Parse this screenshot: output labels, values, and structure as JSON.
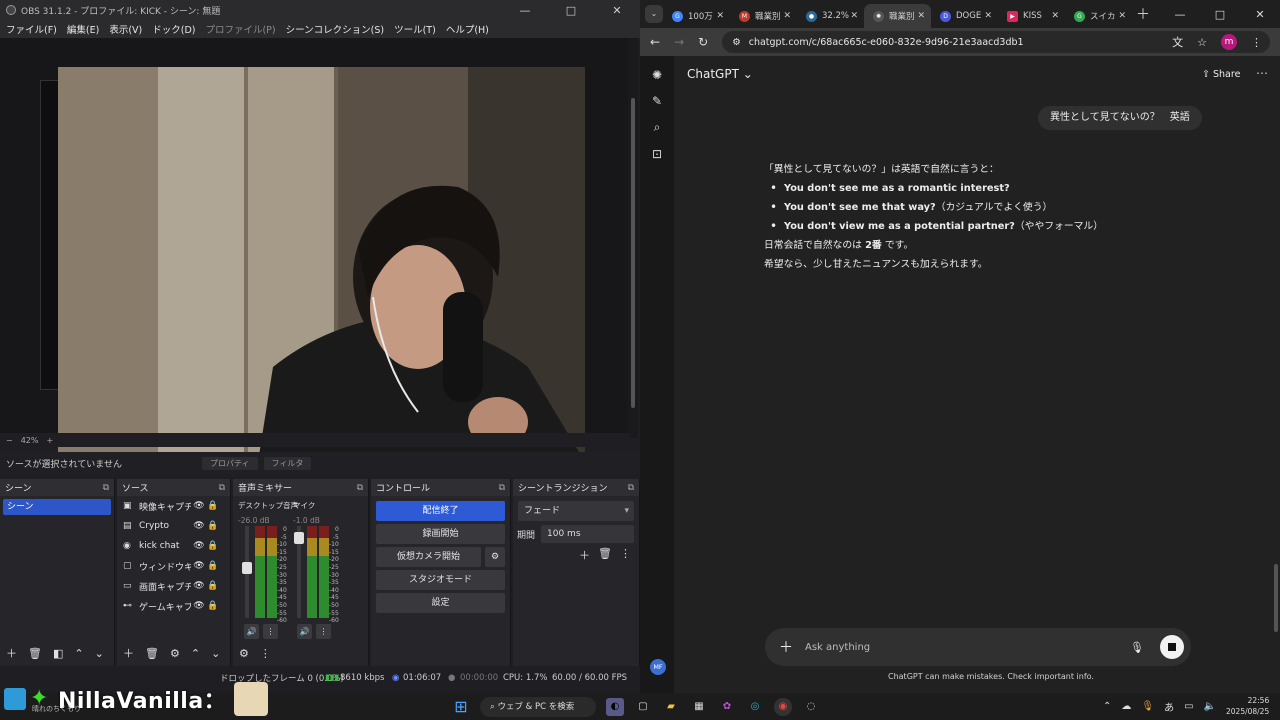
{
  "obs": {
    "title": "OBS 31.1.2 - プロファイル: KICK - シーン: 無題",
    "window_buttons": [
      "—",
      "□",
      "✕"
    ],
    "menu": [
      "ファイル(F)",
      "編集(E)",
      "表示(V)",
      "ドック(D)",
      "プロファイル(P)",
      "シーンコレクション(S)",
      "ツール(T)",
      "ヘルプ(H)"
    ],
    "zoom": "42%",
    "source_status": "ソースが選択されていません",
    "source_buttons": [
      "プロパティ",
      "フィルタ"
    ],
    "docks": {
      "scenes": {
        "title": "シーン",
        "items": [
          "シーン"
        ]
      },
      "sources": {
        "title": "ソース",
        "items": [
          {
            "icon": "camera-icon",
            "glyph": "▣",
            "name": "映像キャプチャ"
          },
          {
            "icon": "text-icon",
            "glyph": "▤",
            "name": "Crypto"
          },
          {
            "icon": "browser-icon",
            "glyph": "◉",
            "name": "kick chat"
          },
          {
            "icon": "window-icon",
            "glyph": "▢",
            "name": "ウィンドウキャプ"
          },
          {
            "icon": "display-icon",
            "glyph": "▭",
            "name": "画面キャプチャ"
          },
          {
            "icon": "gamepad-icon",
            "glyph": "⊷",
            "name": "ゲームキャプチャ"
          }
        ]
      },
      "mixer": {
        "title": "音声ミキサー",
        "channels": [
          {
            "name": "デスクトップ音声",
            "db": "-26.0 dB",
            "level": 0.55
          },
          {
            "name": "マイク",
            "db": "-1.0 dB",
            "level": 0.93
          }
        ],
        "scale": [
          "0",
          "-5",
          "-10",
          "-15",
          "-20",
          "-25",
          "-30",
          "-35",
          "-40",
          "-45",
          "-50",
          "-55",
          "-60"
        ]
      },
      "controls": {
        "title": "コントロール",
        "buttons": [
          "配信終了",
          "録画開始",
          "仮想カメラ開始",
          "スタジオモード",
          "設定"
        ]
      },
      "transitions": {
        "title": "シーントランジション",
        "selected": "フェード",
        "duration_label": "期間",
        "duration_value": "100 ms"
      }
    },
    "status": {
      "dropped": "ドロップしたフレーム 0 (0.0%)",
      "bitrate": "8610 kbps",
      "stream_time": "01:06:07",
      "rec_time": "00:00:00",
      "cpu": "CPU: 1.7%",
      "fps": "60.00 / 60.00 FPS"
    }
  },
  "chrome": {
    "tabs": [
      {
        "title": "100万",
        "color": "#4285f4",
        "glyph": "G"
      },
      {
        "title": "職業別",
        "color": "#c0392b",
        "glyph": "M"
      },
      {
        "title": "32.2%",
        "color": "#2a6a9a",
        "glyph": "●"
      },
      {
        "title": "職業別",
        "color": "#555555",
        "glyph": "✺",
        "active": true
      },
      {
        "title": "DOGE",
        "color": "#4b5bd6",
        "glyph": "D"
      },
      {
        "title": "KISS",
        "color": "#e0245e",
        "glyph": "▶"
      },
      {
        "title": "スイカ",
        "color": "#34a853",
        "glyph": "G"
      }
    ],
    "url": "chatgpt.com/c/68ac665c-e060-832e-9d96-21e3aacd3db1",
    "profile_initial": "m"
  },
  "chatgpt": {
    "model": "ChatGPT",
    "share": "Share",
    "user_message": "異性として見てないの？　英語",
    "answer_intro": "「異性として見てないの？」は英語で自然に言うと：",
    "answer_items": [
      {
        "bold": "You don't see me as a romantic interest?",
        "note": ""
      },
      {
        "bold": "You don't see me that way?",
        "note": "（カジュアルでよく使う）"
      },
      {
        "bold": "You don't view me as a potential partner?",
        "note": "（ややフォーマル）"
      }
    ],
    "answer_line1_pre": "日常会話で自然なのは ",
    "answer_line1_bold": "2番",
    "answer_line1_post": " です。",
    "answer_line2": "希望なら、少し甘えたニュアンスも加えられます。",
    "composer_placeholder": "Ask anything",
    "disclaimer": "ChatGPT can make mistakes. Check important info.",
    "user_initials": "MF"
  },
  "taskbar": {
    "overlay_name": "NillaVanilla：",
    "weather": "晴れのちくもり",
    "search": "ウェブ & PC を検索",
    "time": "22:56",
    "date": "2025/08/25"
  }
}
